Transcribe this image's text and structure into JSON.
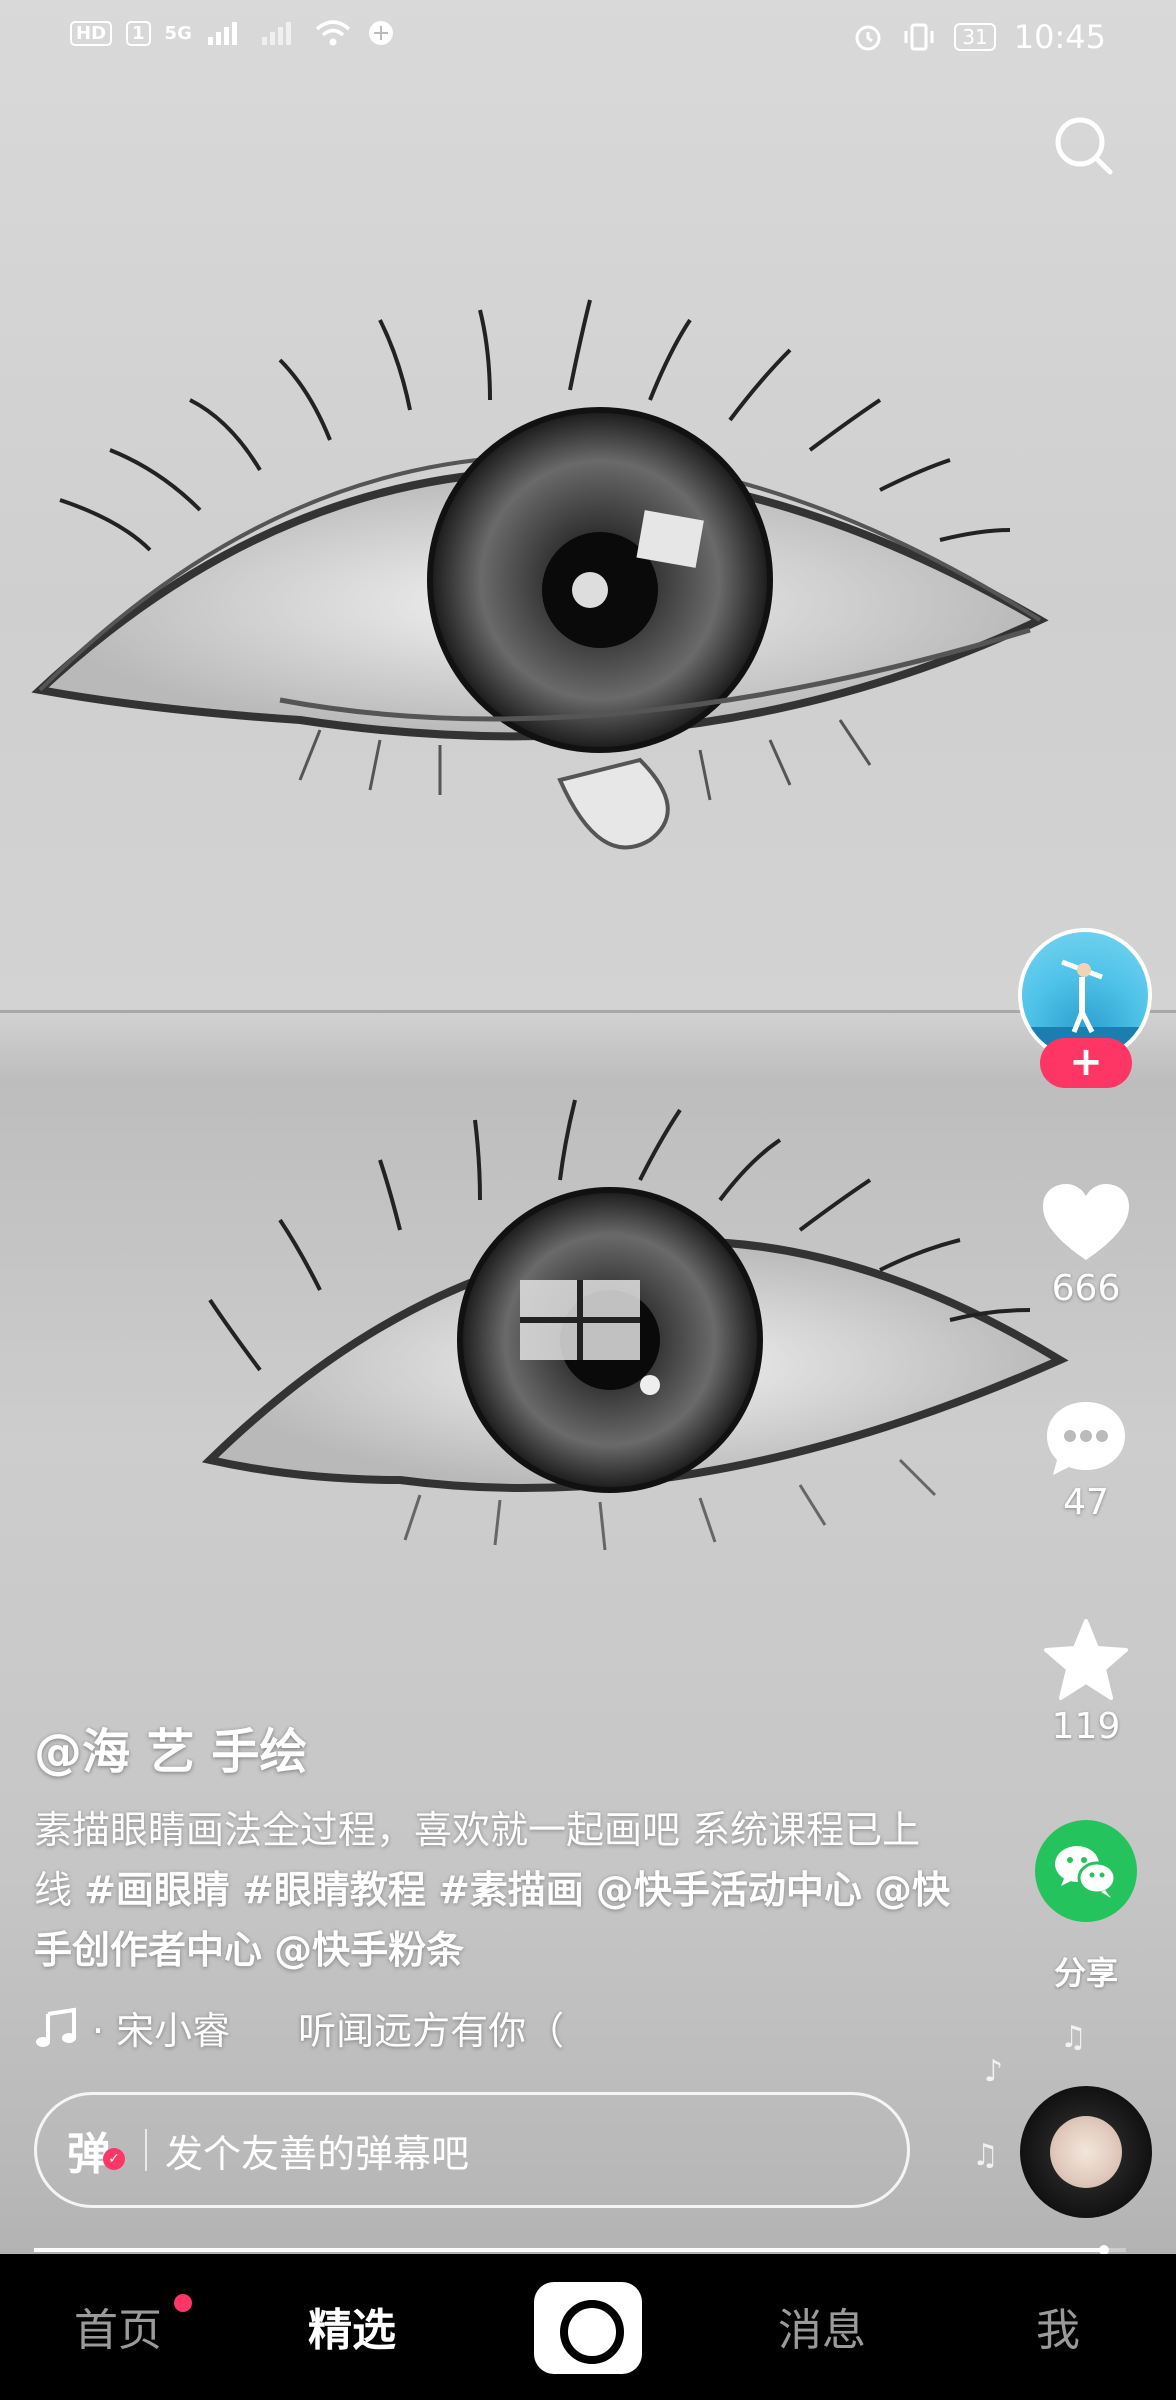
{
  "status_bar": {
    "hd": "HD",
    "sim": "1",
    "network": "5G",
    "battery": "31",
    "time": "10:45"
  },
  "actions": {
    "likes": "666",
    "comments": "47",
    "favorites": "119",
    "share_label": "分享"
  },
  "video": {
    "author": "@海  艺 手绘",
    "caption_text": "素描眼睛画法全过程，喜欢就一起画吧 系统课程已上线 ",
    "tags": [
      "#画眼睛",
      "#眼睛教程",
      "#素描画"
    ],
    "mentions": [
      "@快手活动中心",
      "@快手创作者中心",
      "@快手粉条"
    ],
    "music_artist": "· 宋小睿",
    "music_title": "听闻远方有你（",
    "progress": 0.98
  },
  "danmu": {
    "icon_label": "弹",
    "placeholder": "发个友善的弹幕吧"
  },
  "nav": {
    "home": "首页",
    "featured": "精选",
    "messages": "消息",
    "me": "我"
  },
  "colors": {
    "accent_red": "#fe3666",
    "share_green": "#24c35e"
  },
  "icons": [
    "search-icon",
    "heart-icon",
    "comment-icon",
    "star-icon",
    "wechat-icon",
    "music-note-icon",
    "camera-icon"
  ]
}
